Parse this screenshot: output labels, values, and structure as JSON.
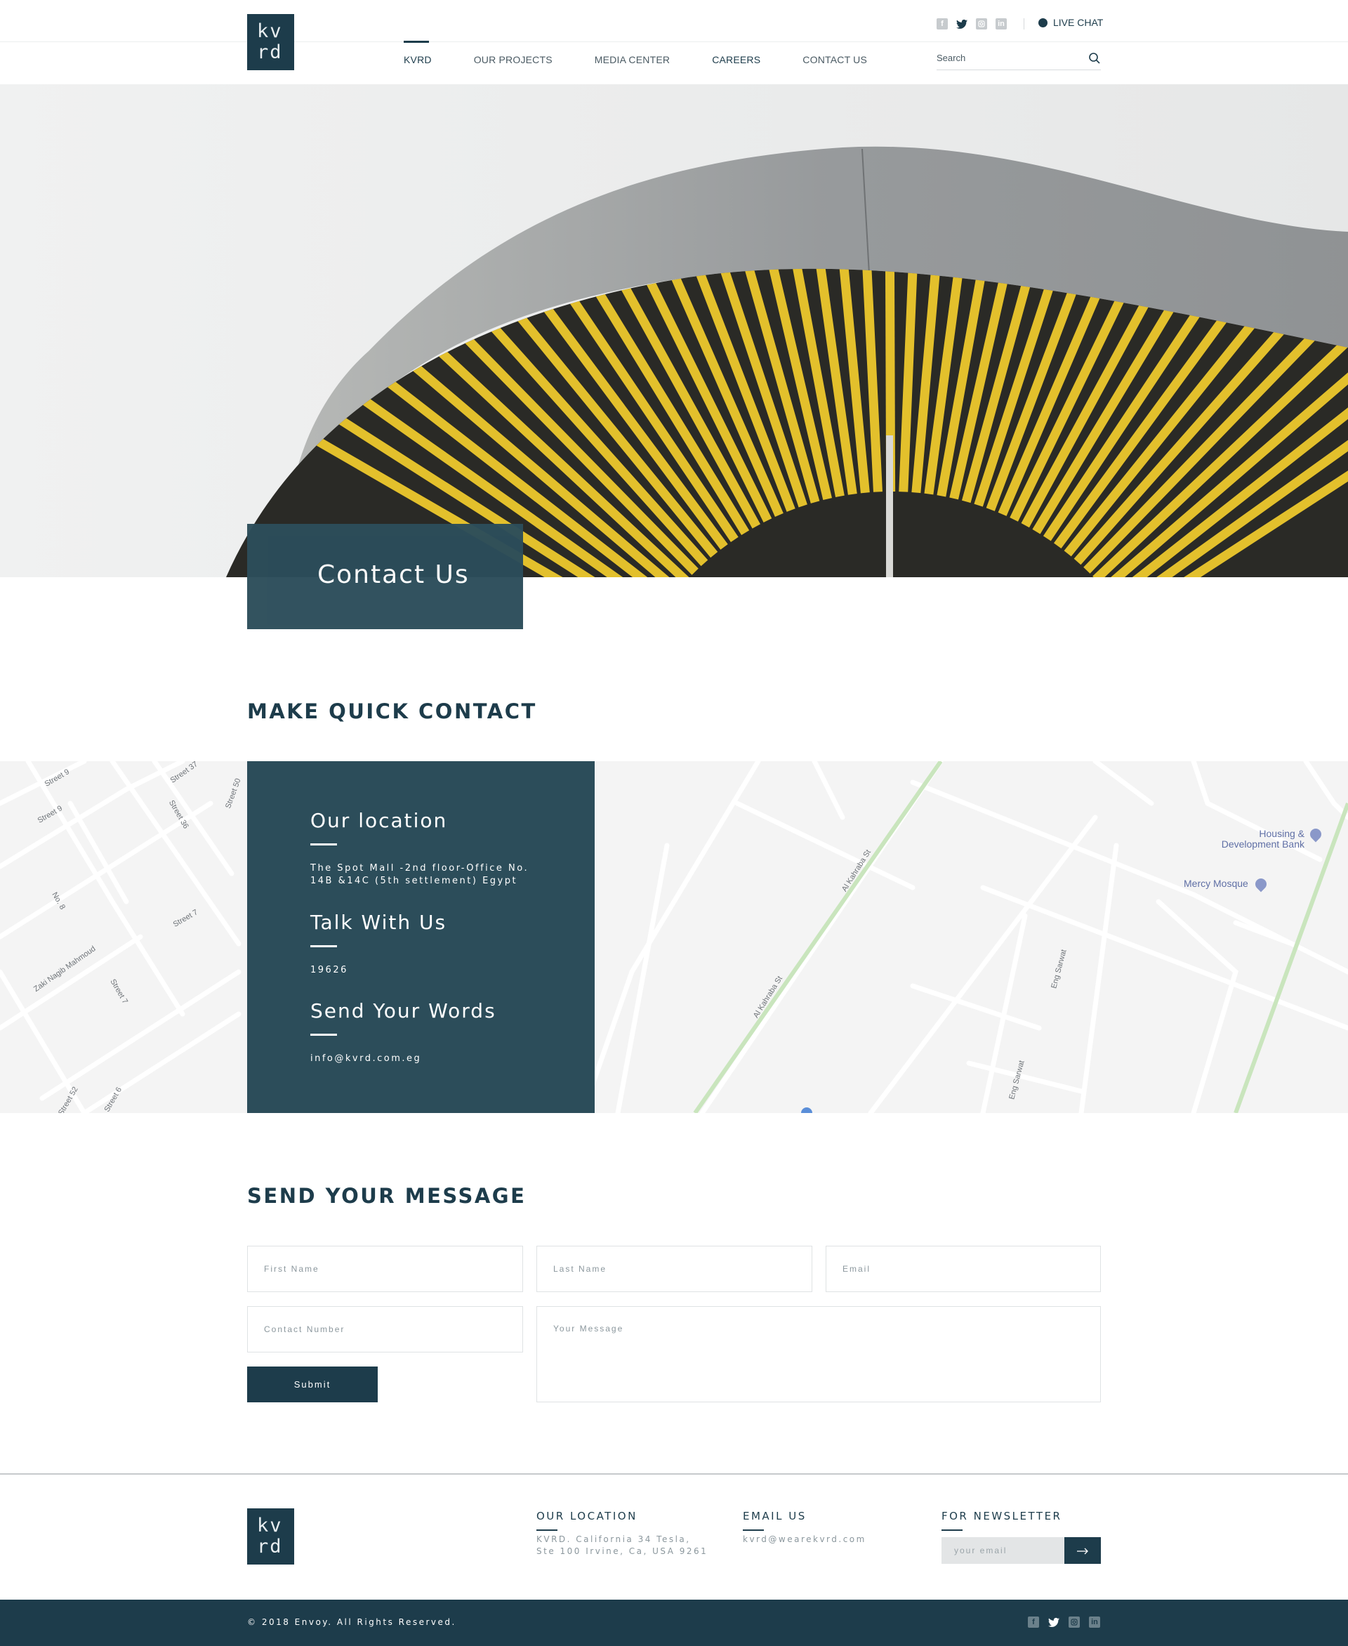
{
  "brand": {
    "logo_top": "kv",
    "logo_bottom": "rd"
  },
  "header": {
    "nav": [
      {
        "label": "KVRD",
        "active": true
      },
      {
        "label": "OUR PROJECTS",
        "active": false
      },
      {
        "label": "MEDIA CENTER",
        "active": false
      },
      {
        "label": "CAREERS",
        "active": false
      },
      {
        "label": "CONTACT US",
        "active": false
      }
    ],
    "social_icons": [
      "facebook-icon",
      "twitter-icon",
      "instagram-icon",
      "linkedin-icon"
    ],
    "live_chat_label": "LIVE CHAT",
    "search_placeholder": "Search"
  },
  "hero": {
    "title": "Contact Us"
  },
  "quick_contact": {
    "heading": "MAKE QUICK CONTACT",
    "location_heading": "Our location",
    "location_line1": "The Spot Mall -2nd floor-Office No.",
    "location_line2": "14B &14C (5th settlement) Egypt",
    "talk_heading": "Talk With Us",
    "phone": "19626",
    "words_heading": "Send Your Words",
    "email": "info@kvrd.com.eg"
  },
  "map": {
    "street_labels": [
      "Street 9",
      "Street 9",
      "Street 37",
      "Street 36",
      "Street 50",
      "Street 7",
      "No. 8",
      "Zaki Nagib Mahmoud",
      "Street 7",
      "Street 52",
      "Street 6",
      "Al Kahraba St",
      "Al Kahraba St",
      "Eng Sarwat",
      "Eng Sarwat"
    ],
    "pois": [
      "Housing & Development Bank",
      "Mercy Mosque"
    ]
  },
  "message_form": {
    "heading": "SEND YOUR MESSAGE",
    "first_name_placeholder": "First Name",
    "last_name_placeholder": "Last Name",
    "email_placeholder": "Email",
    "contact_number_placeholder": "Contact Number",
    "message_placeholder": "Your Message",
    "submit_label": "Submit"
  },
  "footer": {
    "location_title": "OUR LOCATION",
    "location_line1": "KVRD. California 34 Tesla,",
    "location_line2": "Ste 100 Irvine, Ca, USA 9261",
    "email_title": "EMAIL US",
    "email": "kvrd@wearekvrd.com",
    "newsletter_title": "FOR NEWSLETTER",
    "newsletter_placeholder": "your email",
    "newsletter_button_icon": "arrow-right-icon",
    "copyright": "© 2018 Envoy. All Rights Reserved."
  },
  "colors": {
    "primary": "#1d3c4b",
    "card": "#2c4d5a",
    "accent_yellow": "#e6c22e",
    "map_bg": "#f4f4f4"
  }
}
